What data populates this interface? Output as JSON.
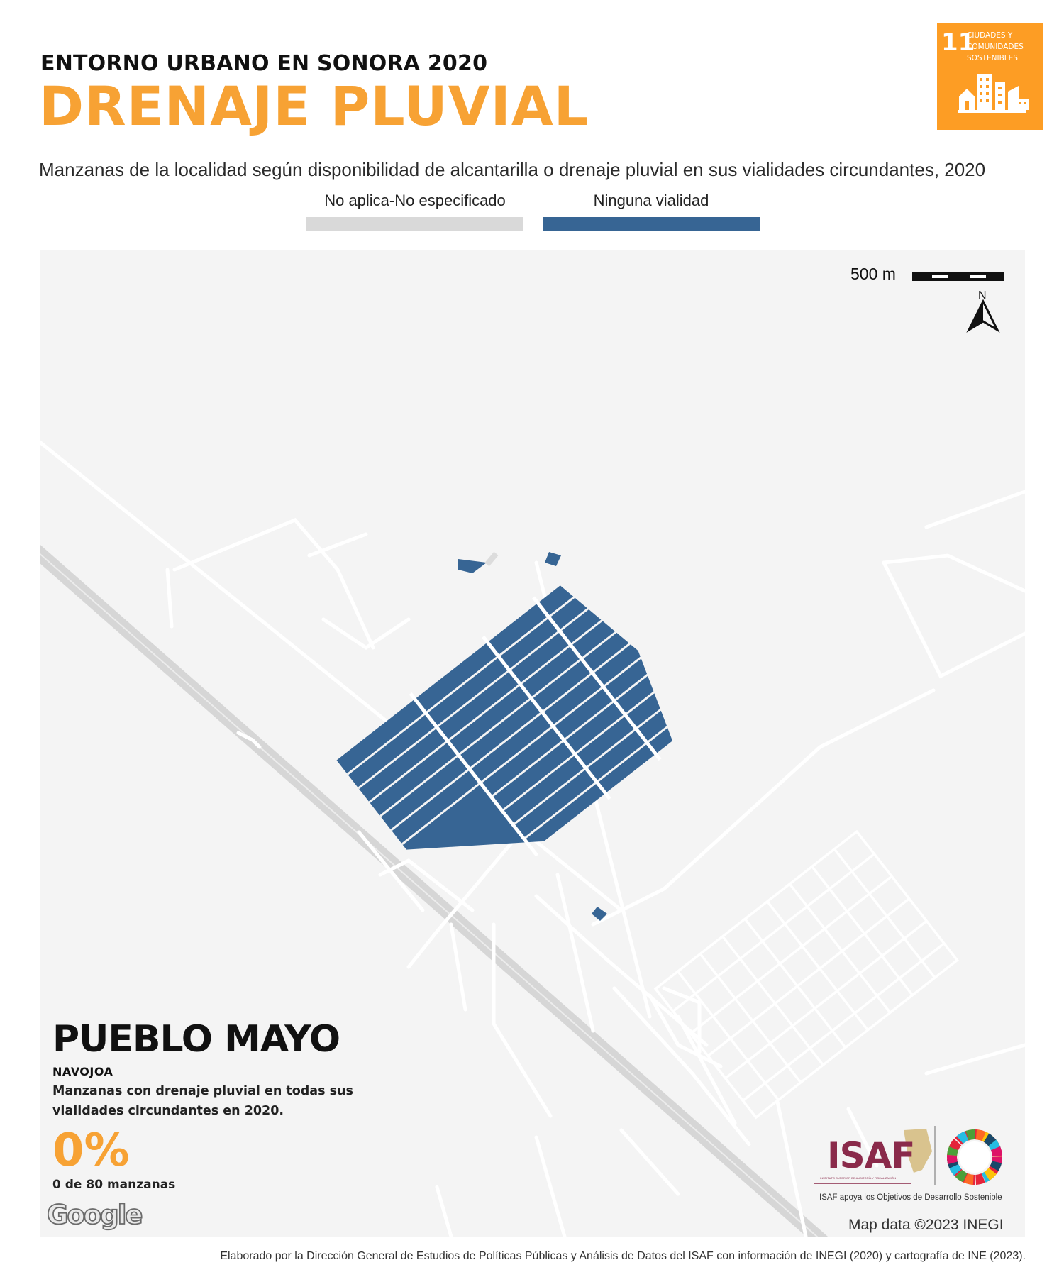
{
  "header": {
    "kicker": "ENTORNO URBANO EN SONORA 2020",
    "title": "DRENAJE PLUVIAL",
    "subtitle": "Manzanas de la localidad según disponibilidad de alcantarilla o drenaje pluvial en sus vialidades circundantes, 2020"
  },
  "sdg": {
    "number": "11",
    "line1": "CIUDADES Y",
    "line2": "COMUNIDADES",
    "line3": "SOSTENIBLES",
    "color": "#FD9D24",
    "icon": "city-buildings-icon"
  },
  "legend": [
    {
      "label": "No aplica-No especificado",
      "color": "#D9D9D9"
    },
    {
      "label": "Ninguna vialidad",
      "color": "#376594"
    }
  ],
  "map": {
    "background": "#F4F4F4",
    "road_color": "#FFFFFF",
    "highway_color": "#D6D6D6",
    "block_color": "#376594",
    "scale_label": "500 m",
    "north_label": "N",
    "attribution": "Map data ©2023 INEGI",
    "google_logo": "Google"
  },
  "place": {
    "name": "PUEBLO MAYO",
    "municipality": "NAVOJOA",
    "description_line1": "Manzanas con drenaje pluvial en todas sus",
    "description_line2": "vialidades circundantes en 2020.",
    "percentage": "0%",
    "percentage_color": "#F7A234",
    "count": "0 de 80 manzanas"
  },
  "isaf": {
    "logo_text": "ISAF",
    "logo_subtext": "INSTITUTO SUPERIOR DE AUDITORÍA Y FISCALIZACIÓN",
    "tagline": "ISAF apoya los Objetivos de Desarrollo Sostenible",
    "color": "#8A2A4A",
    "sdg_wheel_icon": "sdg-wheel-icon"
  },
  "footer": {
    "credit": "Elaborado por la Dirección General de Estudios de Políticas Públicas y Análisis de Datos del ISAF con información de INEGI (2020) y cartografía de INE (2023)."
  },
  "colors": {
    "accent": "#F7A234",
    "dark": "#111111"
  }
}
